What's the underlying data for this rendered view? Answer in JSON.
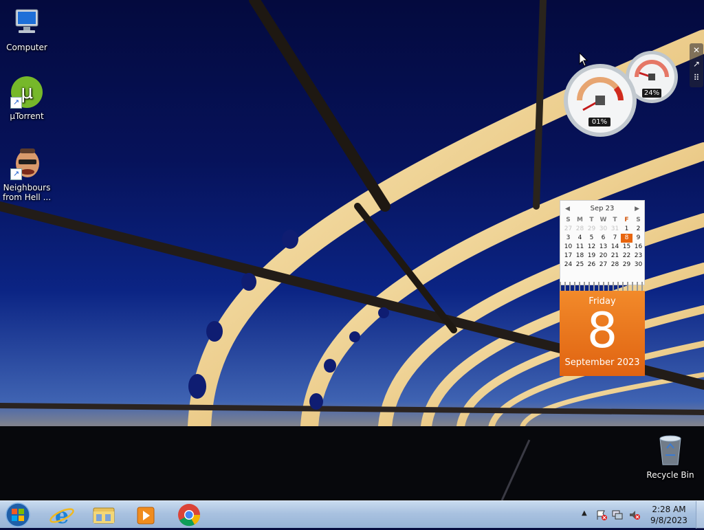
{
  "desktop_icons": [
    {
      "label": "Computer",
      "icon": "computer-icon"
    },
    {
      "label": "µTorrent",
      "icon": "utorrent-icon"
    },
    {
      "label": "Neighbours from Hell ...",
      "icon": "game-icon"
    }
  ],
  "recycle_bin": {
    "label": "Recycle Bin",
    "icon": "recycle-bin-icon"
  },
  "gadget_controls": [
    "close-icon",
    "options-icon",
    "drag-handle-icon"
  ],
  "cpu_meter": {
    "cpu_percent": "01%",
    "memory_percent": "24%"
  },
  "calendar": {
    "month_label": "Sep 23",
    "weekdays": [
      "S",
      "M",
      "T",
      "W",
      "T",
      "F",
      "S"
    ],
    "days": [
      [
        "27",
        "28",
        "29",
        "30",
        "31",
        "1",
        "2"
      ],
      [
        "3",
        "4",
        "5",
        "6",
        "7",
        "8",
        "9"
      ],
      [
        "10",
        "11",
        "12",
        "13",
        "14",
        "15",
        "16"
      ],
      [
        "17",
        "18",
        "19",
        "20",
        "21",
        "22",
        "23"
      ],
      [
        "24",
        "25",
        "26",
        "27",
        "28",
        "29",
        "30"
      ]
    ],
    "today": "8",
    "day_name": "Friday",
    "day_number": "8",
    "month_year": "September 2023",
    "accent": "#e8650e"
  },
  "taskbar": {
    "start": "windows-start-icon",
    "pinned": [
      "internet-explorer-icon",
      "file-explorer-icon",
      "media-player-icon",
      "chrome-icon"
    ],
    "tray_icons": [
      "show-hidden-icons-arrow",
      "action-center-flag-icon",
      "network-icon",
      "volume-muted-icon"
    ],
    "time": "2:28 AM",
    "date": "9/8/2023"
  }
}
